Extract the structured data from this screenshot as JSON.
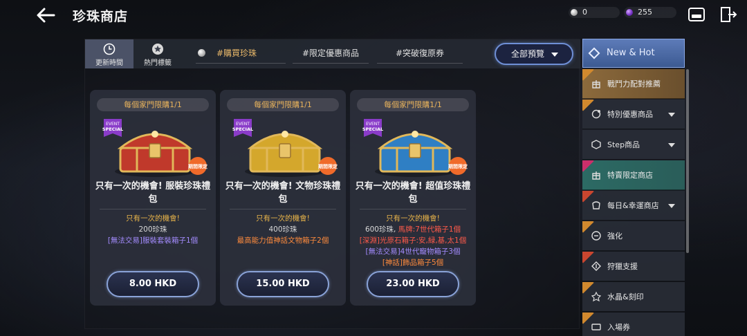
{
  "header": {
    "title": "珍珠商店",
    "currency_pearl": "0",
    "currency_gem": "255"
  },
  "tabs": {
    "update_time": "更新時間",
    "hot_tags": "熱門標籤",
    "buy_pearl": "#購買珍珠",
    "limited_offer": "#限定優惠商品",
    "break_restore": "#突破復原券",
    "preview_all": "全部預覽"
  },
  "cards": [
    {
      "limit": "每個家門限購1/1",
      "badge_event": "EVENT",
      "badge_special": "SPECIAL",
      "badge_period": "期間限定",
      "title": "只有一次的機會! 服裝珍珠禮包",
      "desc": [
        {
          "text": "只有一次的機會!",
          "color": "gold"
        },
        {
          "text": "200珍珠",
          "color": "light"
        },
        {
          "text": "[無法交易]服裝套裝箱子1個",
          "color": "purple"
        }
      ],
      "price": "8.00 HKD",
      "chest_color": "#c0392b"
    },
    {
      "limit": "每個家門限購1/1",
      "badge_event": "EVENT",
      "badge_special": "SPECIAL",
      "badge_period": "期間限定",
      "title": "只有一次的機會! 文物珍珠禮包",
      "desc": [
        {
          "text": "只有一次的機會!",
          "color": "gold"
        },
        {
          "text": "400珍珠",
          "color": "light"
        },
        {
          "text": "最高能力值神話文物箱子2個",
          "color": "orange"
        }
      ],
      "price": "15.00 HKD",
      "chest_color": "#d4a72c"
    },
    {
      "limit": "每個家門限購1/1",
      "badge_event": "EVENT",
      "badge_special": "SPECIAL",
      "badge_period": "期間限定",
      "title": "只有一次的機會! 超值珍珠禮包",
      "desc": [
        {
          "text": "只有一次的機會!",
          "color": "gold"
        },
        {
          "text": "600珍珠, 馬牌:7世代箱子1個",
          "color": "mixed1"
        },
        {
          "text": "[深淵]光原石箱子:安,緑,基,太1個",
          "color": "red"
        },
        {
          "text": "[無法交易]4世代寵物箱子3個",
          "color": "purple"
        },
        {
          "text": "[神話]飾品箱子5個",
          "color": "orange"
        }
      ],
      "price": "23.00 HKD",
      "chest_color": "#2f7fc4"
    }
  ],
  "sidebar": {
    "head": "New & Hot",
    "items": [
      {
        "label": "戰鬥力配對推薦",
        "ribbon": "new",
        "arrow": false
      },
      {
        "label": "特別優惠商品",
        "ribbon": "new",
        "arrow": true
      },
      {
        "label": "Step商品",
        "ribbon": "",
        "arrow": true
      },
      {
        "label": "特賣限定商店",
        "ribbon": "limited",
        "arrow": false
      },
      {
        "label": "每日&幸運商店",
        "ribbon": "hot",
        "arrow": true
      },
      {
        "label": "強化",
        "ribbon": "new",
        "arrow": false
      },
      {
        "label": "狩獵支援",
        "ribbon": "hot",
        "arrow": false
      },
      {
        "label": "水晶&刻印",
        "ribbon": "new",
        "arrow": false
      },
      {
        "label": "入場券",
        "ribbon": "new",
        "arrow": false
      }
    ]
  },
  "colors": {
    "accent_blue": "#6f8fd6",
    "gold_text": "#e8b44a",
    "active_gold": "#8c6a3c",
    "active_teal": "#2c6a64"
  }
}
